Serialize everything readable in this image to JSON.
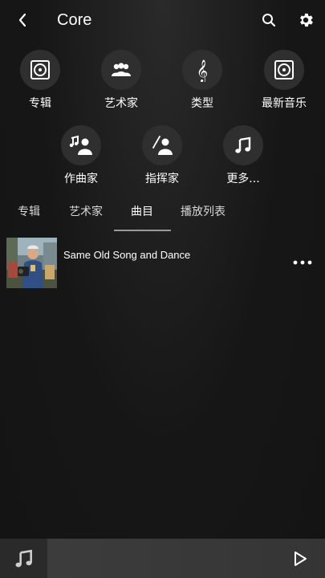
{
  "header": {
    "title": "Core",
    "icons": {
      "back": "chevron-left-icon",
      "search": "search-icon",
      "settings": "gear-icon"
    }
  },
  "categories": [
    {
      "label": "专辑",
      "icon": "disc-icon"
    },
    {
      "label": "艺术家",
      "icon": "group-icon"
    },
    {
      "label": "类型",
      "icon": "treble-clef-icon"
    },
    {
      "label": "最新音乐",
      "icon": "disc-icon"
    },
    {
      "label": "作曲家",
      "icon": "composer-icon"
    },
    {
      "label": "指挥家",
      "icon": "conductor-icon"
    },
    {
      "label": "更多...",
      "icon": "music-note-icon"
    }
  ],
  "tabs": [
    {
      "label": "专辑",
      "active": false
    },
    {
      "label": "艺术家",
      "active": false
    },
    {
      "label": "曲目",
      "active": true
    },
    {
      "label": "播放列表",
      "active": false
    }
  ],
  "tracks": [
    {
      "title": "Same Old Song and Dance",
      "art": "album-art-photo"
    }
  ],
  "player": {
    "icon": "music-note-icon",
    "play_icon": "play-icon"
  },
  "colors": {
    "background": "#161616",
    "circle": "#2f2f2f",
    "text": "#ffffff",
    "tab_underline": "#9a9a9a",
    "player_bar": "#3c3c3c"
  }
}
